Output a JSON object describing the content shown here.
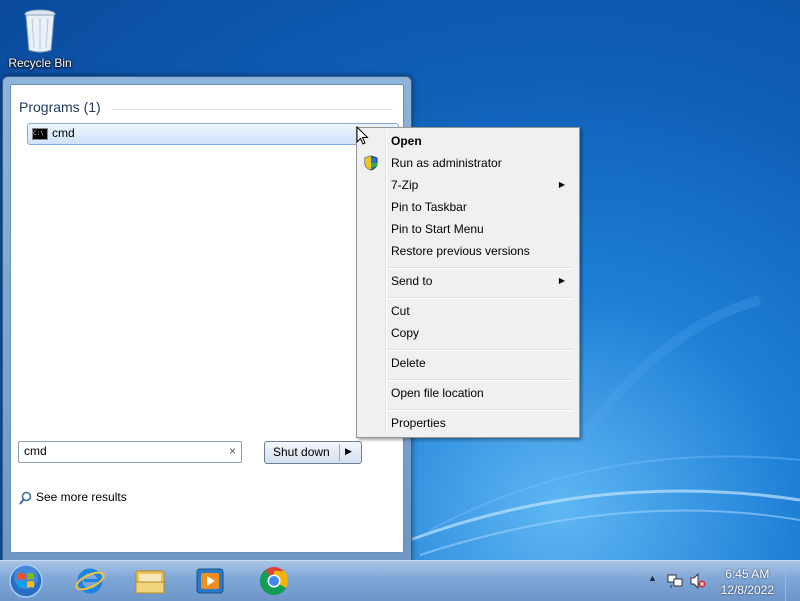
{
  "desktop": {
    "icons": [
      {
        "label": "Recycle Bin",
        "icon": "recycle-bin-icon"
      }
    ]
  },
  "start_menu": {
    "programs_header": "Programs (1)",
    "results": [
      {
        "label": "cmd",
        "icon": "cmd-icon"
      }
    ],
    "see_more": "See more results",
    "search": {
      "value": "cmd",
      "clear": "×"
    },
    "shutdown_label": "Shut down"
  },
  "context_menu": {
    "items": [
      {
        "label": "Open",
        "bold": true
      },
      {
        "label": "Run as administrator",
        "icon": "uac-shield-icon"
      },
      {
        "label": "7-Zip",
        "submenu": true
      },
      {
        "label": "Pin to Taskbar"
      },
      {
        "label": "Pin to Start Menu"
      },
      {
        "label": "Restore previous versions"
      },
      {
        "label": "Send to",
        "submenu": true
      },
      {
        "label": "Cut"
      },
      {
        "label": "Copy"
      },
      {
        "label": "Delete"
      },
      {
        "label": "Open file location"
      },
      {
        "label": "Properties"
      }
    ],
    "submenu_arrow": "▶"
  },
  "taskbar": {
    "pinned": [
      "internet-explorer-icon",
      "windows-explorer-icon",
      "media-player-icon",
      "chrome-icon"
    ],
    "tray_arrow": "▲",
    "time": "6:45 AM",
    "date": "12/8/2022"
  },
  "colors": {
    "accent": "#1e7fd6",
    "menu_bg": "#f0f0f0"
  }
}
